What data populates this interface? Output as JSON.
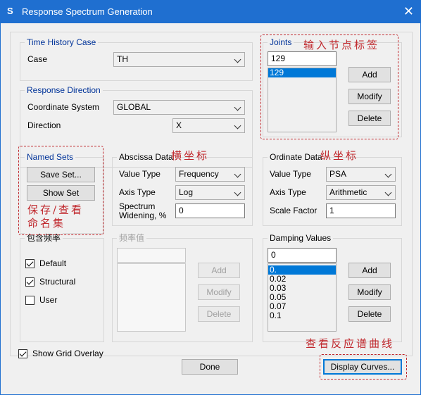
{
  "window": {
    "title": "Response Spectrum Generation",
    "app_icon": "S",
    "close_glyph": "✕"
  },
  "time_history": {
    "title": "Time History Case",
    "case_label": "Case",
    "case_value": "TH"
  },
  "response_direction": {
    "title": "Response Direction",
    "coord_label": "Coordinate System",
    "coord_value": "GLOBAL",
    "direction_label": "Direction",
    "direction_value": "X"
  },
  "joints": {
    "title": "Joints",
    "input_value": "129",
    "items": [
      "129"
    ],
    "add": "Add",
    "modify": "Modify",
    "delete": "Delete"
  },
  "named_sets": {
    "title": "Named Sets",
    "save": "Save Set...",
    "show": "Show Set"
  },
  "abscissa": {
    "title": "Abscissa Data",
    "value_type_label": "Value Type",
    "value_type": "Frequency",
    "axis_type_label": "Axis Type",
    "axis_type": "Log",
    "widening_label_1": "Spectrum",
    "widening_label_2": "Widening, %",
    "widening_value": "0"
  },
  "ordinate": {
    "title": "Ordinate Data",
    "value_type_label": "Value Type",
    "value_type": "PSA",
    "axis_type_label": "Axis Type",
    "axis_type": "Arithmetic",
    "scale_label": "Scale Factor",
    "scale_value": "1"
  },
  "include_freq": {
    "title": "包含频率",
    "default": "Default",
    "structural": "Structural",
    "user": "User",
    "default_checked": true,
    "structural_checked": true,
    "user_checked": false
  },
  "freq_values": {
    "title": "频率值",
    "input_value": "",
    "add": "Add",
    "modify": "Modify",
    "delete": "Delete"
  },
  "damping": {
    "title": "Damping Values",
    "input_value": "0",
    "items": [
      "0.",
      "0.02",
      "0.03",
      "0.05",
      "0.07",
      "0.1"
    ],
    "add": "Add",
    "modify": "Modify",
    "delete": "Delete"
  },
  "show_grid": {
    "label": "Show Grid Overlay",
    "checked": true
  },
  "footer": {
    "done": "Done",
    "display_curves": "Display Curves..."
  },
  "annotations": {
    "joints": "输入节点标签",
    "abscissa": "横坐标",
    "ordinate": "纵坐标",
    "named_sets_1": "保存/查看",
    "named_sets_2": "命名集",
    "display_curves": "查看反应谱曲线"
  },
  "colors": {
    "titlebar": "#1f6fd0",
    "group_title": "#003399",
    "annotation": "#c0282d",
    "selection": "#0078d7"
  }
}
